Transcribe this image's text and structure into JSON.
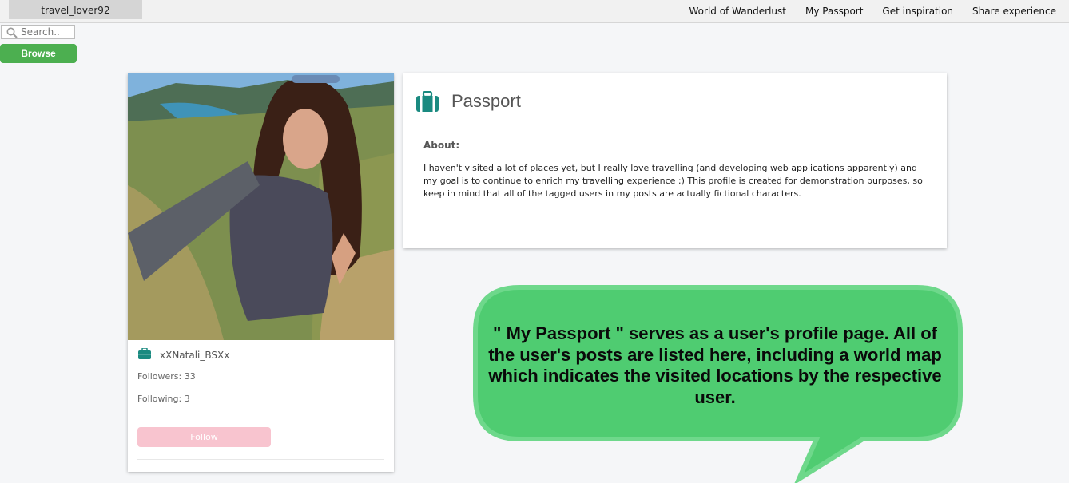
{
  "topbar": {
    "username": "travel_lover92",
    "nav": [
      "World of Wanderlust",
      "My Passport",
      "Get inspiration",
      "Share experience"
    ]
  },
  "search": {
    "placeholder": "Search.."
  },
  "browse_label": "Browse",
  "profile": {
    "username": "xXNatali_BSXx",
    "followers": "Followers: 33",
    "following": "Following: 3",
    "follow_label": "Follow"
  },
  "passport": {
    "title": "Passport",
    "about_label": "About:",
    "about_text": "I haven't visited a lot of places yet, but I really love travelling (and developing web applications apparently) and my goal is to continue to enrich my travelling experience :) This profile is created for demonstration purposes, so keep in mind that all of the tagged users in my posts are actually fictional characters."
  },
  "callout": {
    "text": "\" My Passport \" serves as a user's profile page. All of the user's posts are listed here, including a world map which indicates the visited locations by the respective user."
  },
  "colors": {
    "accent_teal": "#1a8a80",
    "browse_green": "#4caf50",
    "follow_pink": "#f8c4cf",
    "callout_green": "#4fcc71"
  },
  "icons": {
    "search": "search-icon",
    "passport": "briefcase-icon",
    "card": "briefcase-icon"
  }
}
